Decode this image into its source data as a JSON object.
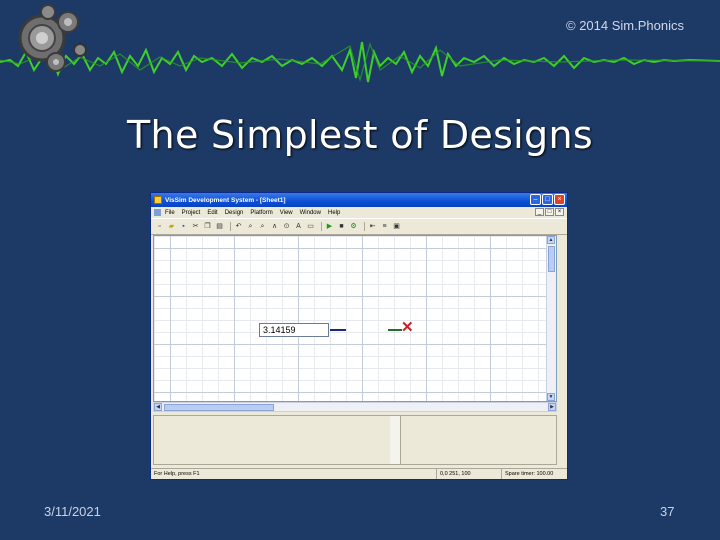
{
  "slide": {
    "copyright": "© 2014 Sim.Phonics",
    "title": "The Simplest of Designs",
    "date": "3/11/2021",
    "page_number": "37"
  },
  "app": {
    "window_title": "VisSim Development System - [Sheet1]",
    "menu": [
      "File",
      "Project",
      "Edit",
      "Design",
      "Platform",
      "View",
      "Window",
      "Help"
    ],
    "window_buttons": [
      "minimize",
      "maximize",
      "close"
    ],
    "toolbar_icons": [
      "new-icon",
      "open-icon",
      "save-icon",
      "cut-icon",
      "copy-icon",
      "paste-icon",
      "undo-icon",
      "zoom-icon",
      "zoom-in-icon",
      "connect-icon",
      "label-icon",
      "text-icon",
      "block-icon",
      "play-icon",
      "stop-icon",
      "step-icon",
      "probe-icon",
      "properties-icon",
      "display-icon"
    ],
    "canvas": {
      "constant_value": "3.14159"
    },
    "status": {
      "left": "For Help, press F1",
      "position": "0,0  251, 100",
      "right": "Spare timer: 100.00"
    }
  },
  "colors": {
    "background": "#1d3a66",
    "wave": "#3ecf2a",
    "terminator": "#c0242a"
  }
}
